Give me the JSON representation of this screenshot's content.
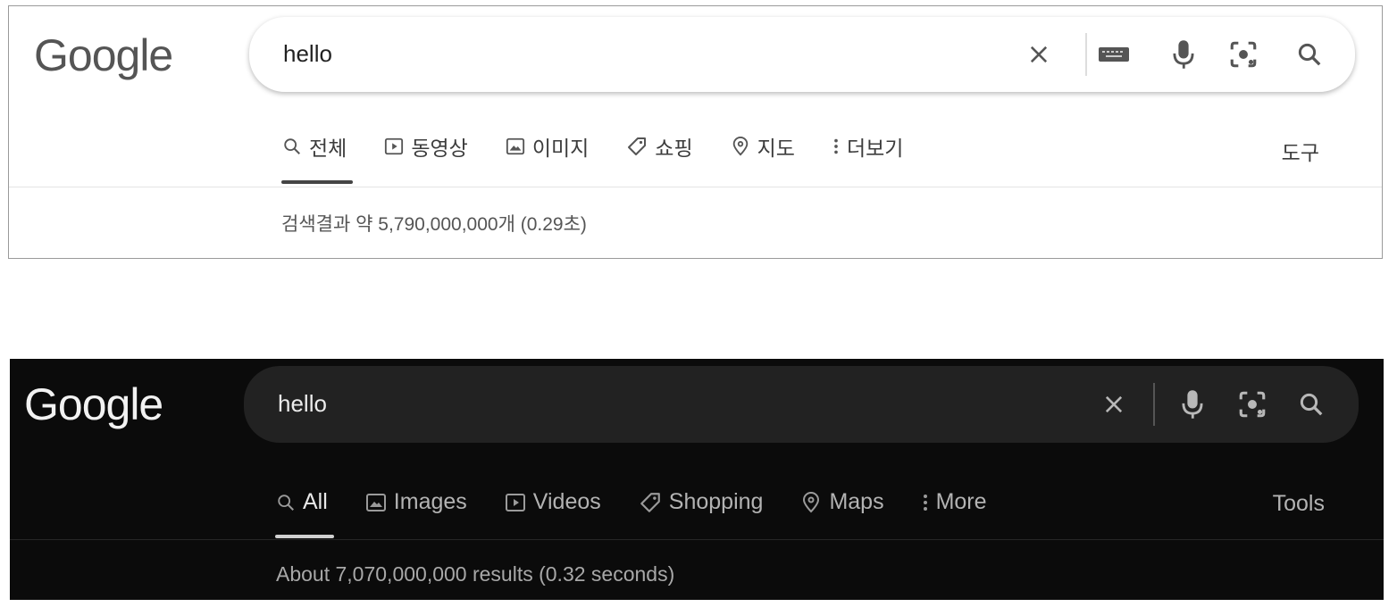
{
  "light": {
    "logo_text": "Google",
    "search": {
      "value": "hello"
    },
    "tabs": [
      {
        "label": "전체",
        "icon": "search-icon"
      },
      {
        "label": "동영상",
        "icon": "video-icon"
      },
      {
        "label": "이미지",
        "icon": "image-icon"
      },
      {
        "label": "쇼핑",
        "icon": "tag-icon"
      },
      {
        "label": "지도",
        "icon": "map-pin-icon"
      },
      {
        "label": "더보기",
        "icon": "more-vertical-icon"
      }
    ],
    "tools_label": "도구",
    "results_text": "검색결과 약 5,790,000,000개 (0.29초)"
  },
  "dark": {
    "logo_text": "Google",
    "search": {
      "value": "hello"
    },
    "tabs": [
      {
        "label": "All",
        "icon": "search-icon"
      },
      {
        "label": "Images",
        "icon": "image-icon"
      },
      {
        "label": "Videos",
        "icon": "video-icon"
      },
      {
        "label": "Shopping",
        "icon": "tag-icon"
      },
      {
        "label": "Maps",
        "icon": "map-pin-icon"
      },
      {
        "label": "More",
        "icon": "more-vertical-icon"
      }
    ],
    "tools_label": "Tools",
    "results_text": "About 7,070,000,000 results (0.32 seconds)"
  },
  "colors": {
    "light_bg": "#ffffff",
    "dark_bg": "#0b0b0b",
    "dark_search_bg": "#222222"
  }
}
